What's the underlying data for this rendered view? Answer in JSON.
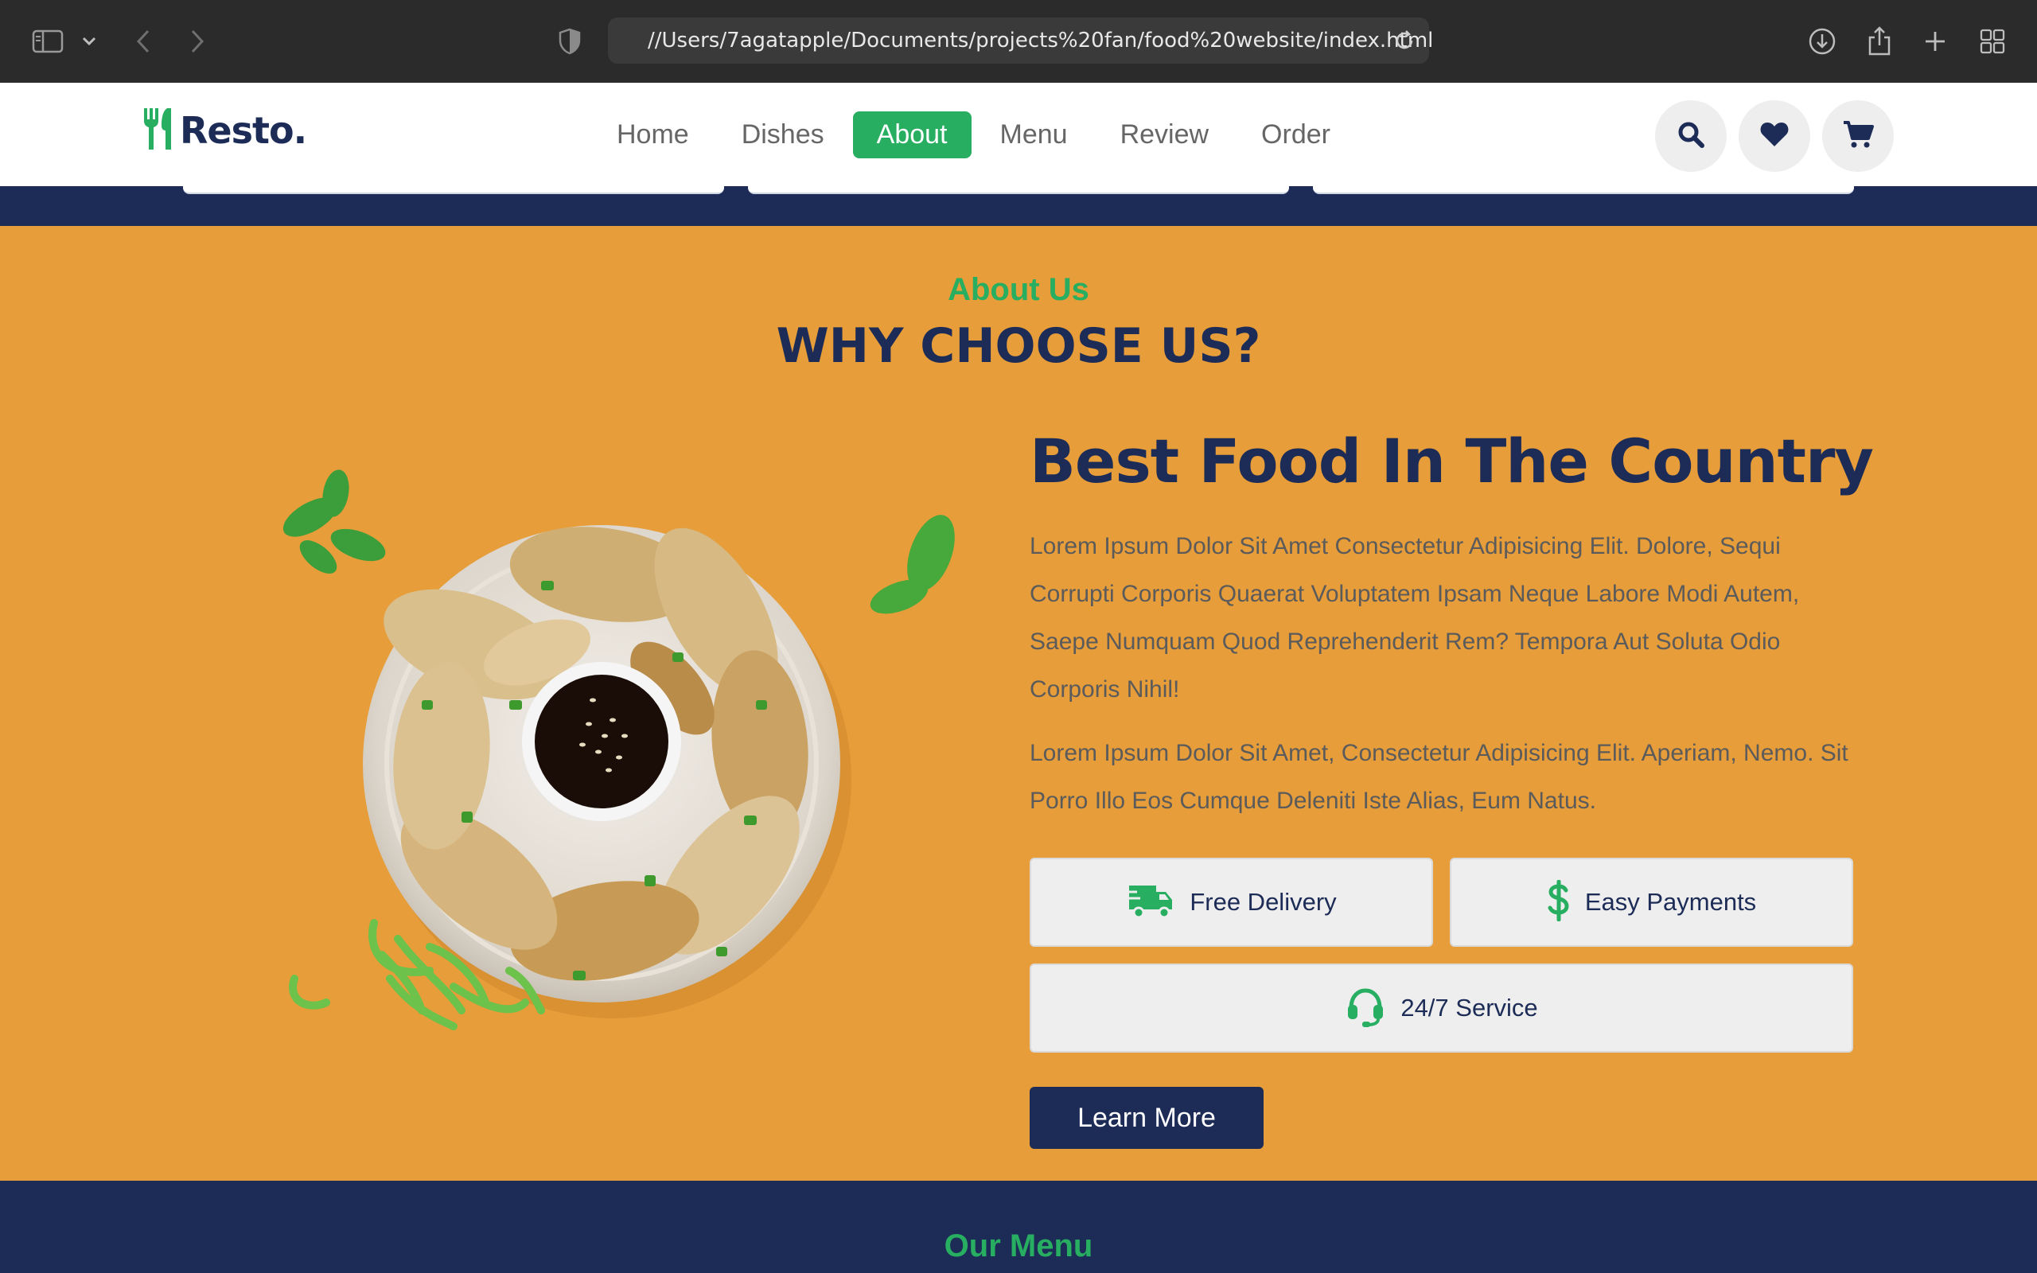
{
  "browser": {
    "url": "//Users/7agatapple/Documents/projects%20fan/food%20website/index.html"
  },
  "header": {
    "logo_text": "Resto.",
    "nav": [
      {
        "label": "Home",
        "active": false
      },
      {
        "label": "Dishes",
        "active": false
      },
      {
        "label": "About",
        "active": true
      },
      {
        "label": "Menu",
        "active": false
      },
      {
        "label": "Review",
        "active": false
      },
      {
        "label": "Order",
        "active": false
      }
    ],
    "icons": [
      "search-icon",
      "heart-icon",
      "cart-icon"
    ]
  },
  "about": {
    "subheading": "About Us",
    "heading": "WHY CHOOSE US?",
    "content_title": "Best Food In The Country",
    "paragraph_1": "Lorem Ipsum Dolor Sit Amet Consectetur Adipisicing Elit. Dolore, Sequi Corrupti Corporis Quaerat Voluptatem Ipsam Neque Labore Modi Autem, Saepe Numquam Quod Reprehenderit Rem? Tempora Aut Soluta Odio Corporis Nihil!",
    "paragraph_2": "Lorem Ipsum Dolor Sit Amet, Consectetur Adipisicing Elit. Aperiam, Nemo. Sit Porro Illo Eos Cumque Deleniti Iste Alias, Eum Natus.",
    "features": [
      {
        "label": "Free Delivery",
        "icon": "truck-icon"
      },
      {
        "label": "Easy Payments",
        "icon": "dollar-icon"
      },
      {
        "label": "24/7 Service",
        "icon": "headset-icon"
      }
    ],
    "button_label": "Learn More"
  },
  "menu": {
    "subheading": "Our Menu"
  },
  "colors": {
    "accent_green": "#27ae60",
    "navy": "#1c2c57",
    "section_orange": "#e69d3a"
  }
}
